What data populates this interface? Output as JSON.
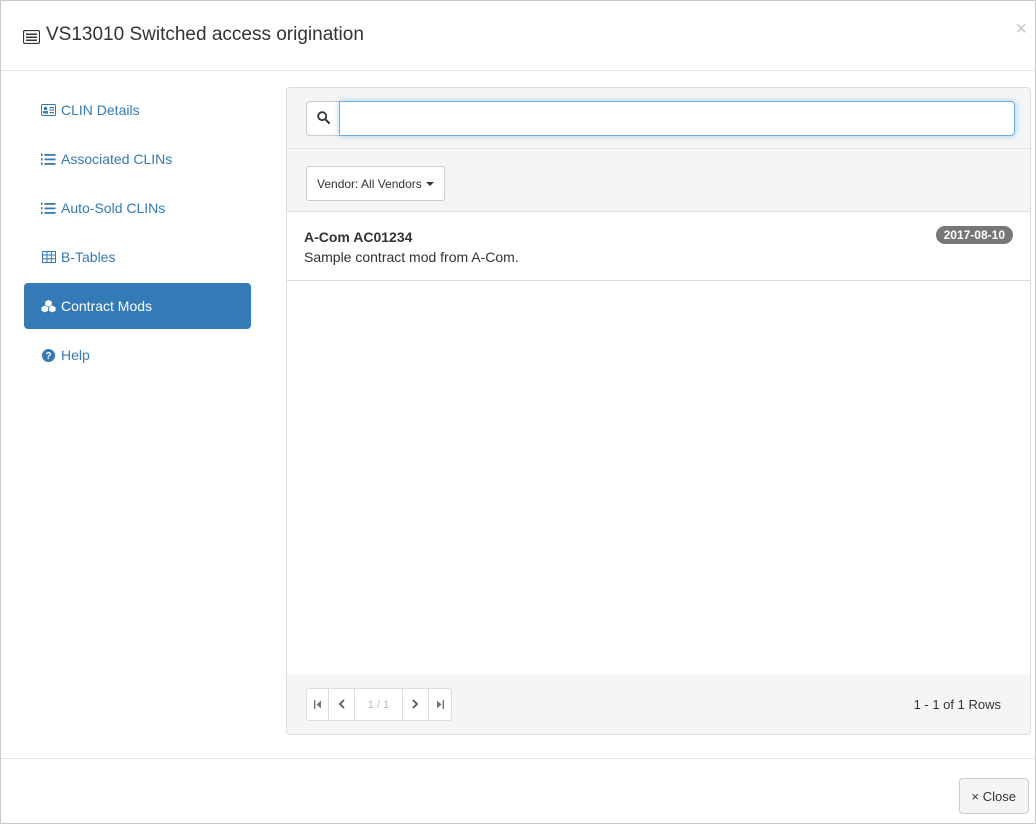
{
  "modal": {
    "title": "VS13010 Switched access origination",
    "close_glyph": "×"
  },
  "sidebar": {
    "items": [
      {
        "label": "CLIN Details",
        "icon": "id-card-icon"
      },
      {
        "label": "Associated CLINs",
        "icon": "list-ordered-icon"
      },
      {
        "label": "Auto-Sold CLINs",
        "icon": "list-ordered-icon"
      },
      {
        "label": "B-Tables",
        "icon": "table-icon"
      },
      {
        "label": "Contract Mods",
        "icon": "cubes-icon",
        "active": true
      },
      {
        "label": "Help",
        "icon": "question-circle-icon"
      }
    ]
  },
  "search": {
    "value": "",
    "icon": "search-icon"
  },
  "filter": {
    "vendor_label": "Vendor: All Vendors"
  },
  "results": [
    {
      "title": "A-Com AC01234",
      "description": "Sample contract mod from A-Com.",
      "date": "2017-08-10"
    }
  ],
  "pagination": {
    "first": "⏮",
    "prev": "<",
    "current": "1 / 1",
    "next": ">",
    "last": "⏭",
    "rows_text": "1 - 1 of 1 Rows"
  },
  "footer": {
    "close_label": "× Close"
  },
  "colors": {
    "accent": "#337ab7",
    "badge": "#777777",
    "focus": "#66afe9"
  }
}
